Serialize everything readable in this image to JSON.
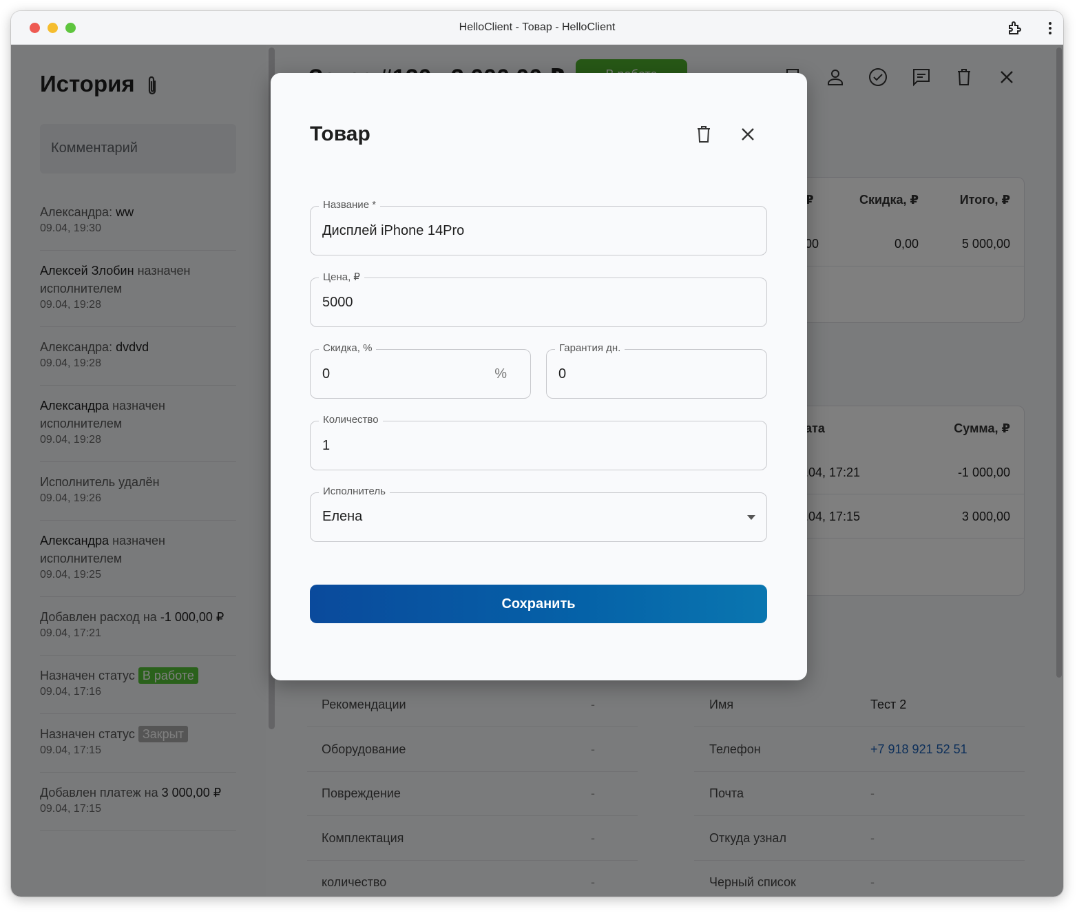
{
  "window": {
    "title": "HelloClient - Товар - HelloClient"
  },
  "sidebar": {
    "title": "История",
    "comment_placeholder": "Комментарий",
    "items": [
      {
        "who": "Александра:",
        "what": "ww",
        "date": "09.04, 19:30"
      },
      {
        "who": "Алексей Злобин",
        "what": "назначен исполнителем",
        "date": "09.04, 19:28"
      },
      {
        "who": "Александра:",
        "what": "dvdvd",
        "date": "09.04, 19:28"
      },
      {
        "who": "Александра",
        "what": "назначен исполнителем",
        "date": "09.04, 19:28"
      },
      {
        "who": "Исполнитель удалён",
        "what": "",
        "date": "09.04, 19:26"
      },
      {
        "who": "Александра",
        "what": "назначен исполнителем",
        "date": "09.04, 19:25"
      },
      {
        "who": "Добавлен расход на",
        "what": "-1 000,00 ₽",
        "date": "09.04, 17:21"
      },
      {
        "who": "Назначен статус",
        "badge": "В работе",
        "date": "09.04, 17:16"
      },
      {
        "who": "Назначен статус",
        "badge": "Закрыт",
        "date": "09.04, 17:15"
      },
      {
        "who": "Добавлен платеж на",
        "what": "3 000,00 ₽",
        "date": "09.04, 17:15"
      }
    ]
  },
  "order": {
    "title": "Заказ #120",
    "amount": "3 000,00 ₽",
    "status_button": "В работе"
  },
  "goods_table": {
    "col_price_tail": "₽",
    "col_discount": "Скидка, ₽",
    "col_total": "Итого, ₽",
    "row_price_tail": "00",
    "row_discount": "0,00",
    "row_total": "5 000,00"
  },
  "payments_table": {
    "col_date_tail": "ата",
    "col_sum": "Сумма, ₽",
    "rows": [
      {
        "date_tail": ".04, 17:21",
        "sum": "-1 000,00"
      },
      {
        "date_tail": ".04, 17:15",
        "sum": "3 000,00"
      }
    ]
  },
  "details_left": [
    {
      "label": "Рекомендации",
      "value": "-"
    },
    {
      "label": "Оборудование",
      "value": "-"
    },
    {
      "label": "Повреждение",
      "value": "-"
    },
    {
      "label": "Комплектация",
      "value": "-"
    },
    {
      "label": "количество",
      "value": "-"
    }
  ],
  "details_right": [
    {
      "label": "Имя",
      "value": "Тест 2"
    },
    {
      "label": "Телефон",
      "value": "+7 918 921 52 51"
    },
    {
      "label": "Почта",
      "value": "-"
    },
    {
      "label": "Откуда узнал",
      "value": "-"
    },
    {
      "label": "Черный список",
      "value": "-"
    }
  ],
  "modal": {
    "title": "Товар",
    "name_label": "Название *",
    "name_value": "Дисплей iPhone 14Pro",
    "price_label": "Цена, ₽",
    "price_value": "5000",
    "discount_label": "Скидка, %",
    "discount_value": "0",
    "discount_suffix": "%",
    "warranty_label": "Гарантия дн.",
    "warranty_value": "0",
    "qty_label": "Количество",
    "qty_value": "1",
    "executor_label": "Исполнитель",
    "executor_value": "Елена",
    "save_label": "Сохранить"
  },
  "colors": {
    "accent": "#0a5aa5",
    "status_green": "#55c336",
    "status_gray": "#aaaaaa",
    "phone_link": "#1a5fb4"
  }
}
